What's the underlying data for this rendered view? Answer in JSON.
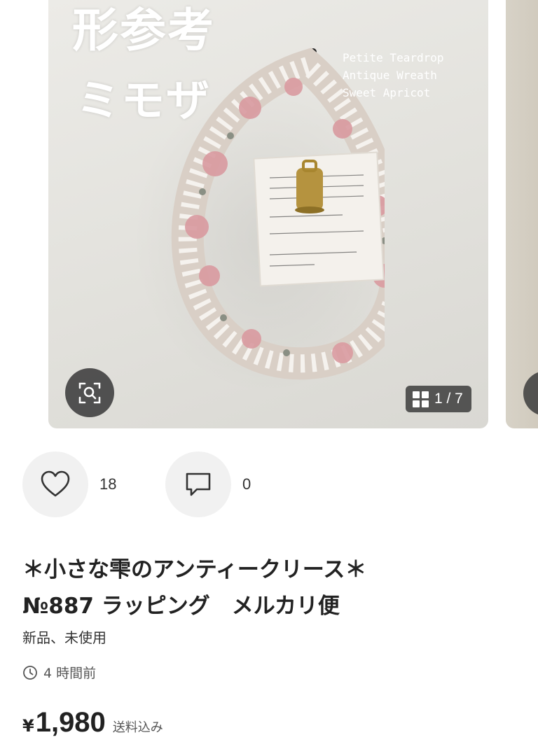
{
  "carousel": {
    "overlay_title_line1": "形参考",
    "overlay_title_line2": "ミモザ",
    "caption_line1": "Petite Teardrop",
    "caption_line2": "Antique Wreath",
    "caption_line3": "Sweet Apricot",
    "counter": "1 / 7"
  },
  "actions": {
    "like_count": "18",
    "comment_count": "0"
  },
  "product": {
    "title_line1": "＊小さな雫のアンティークリース＊",
    "title_line2": "№887 ラッピング　メルカリ便",
    "condition": "新品、未使用",
    "posted": "4 時間前",
    "currency": "¥",
    "price": "1,980",
    "shipping_note": "送料込み"
  },
  "icons": {
    "lens": "image-search-icon",
    "grid": "grid-icon",
    "heart": "heart-icon",
    "comment": "comment-icon",
    "clock": "clock-icon"
  }
}
